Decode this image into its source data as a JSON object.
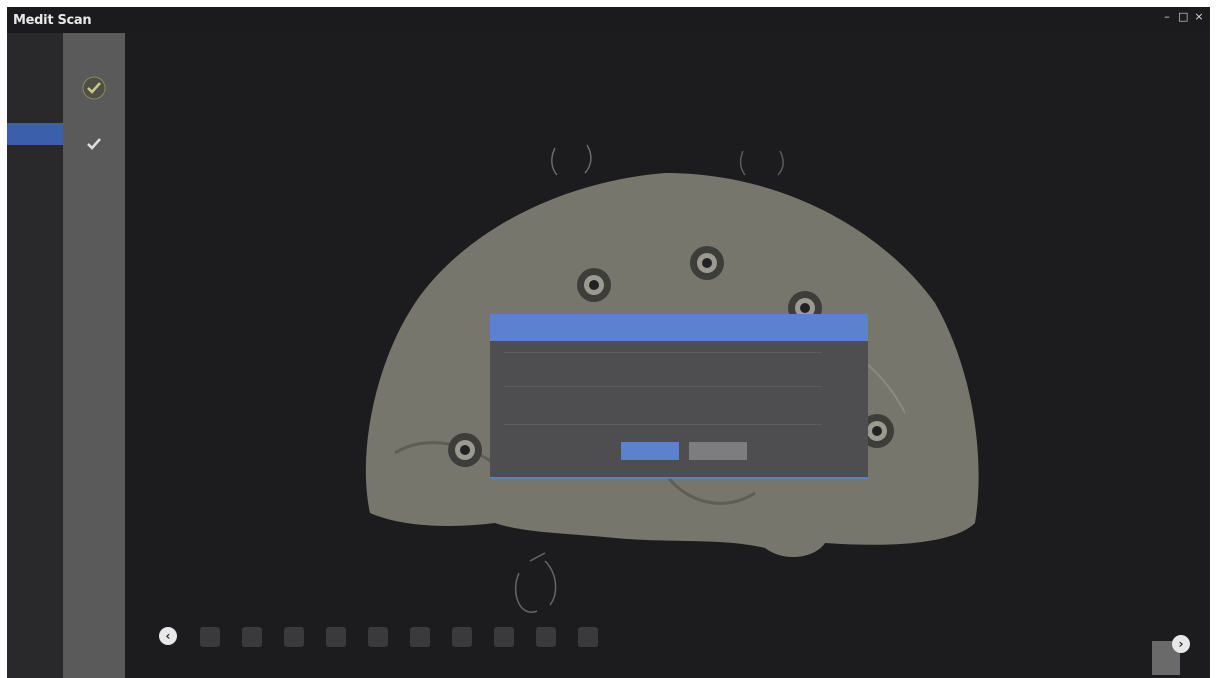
{
  "app": {
    "title": "Medit Scan",
    "version": ""
  },
  "window_controls": {
    "minimize": "–",
    "maximize": "□",
    "close": "×"
  },
  "sidebar": {
    "items": [
      {
        "label": ""
      },
      {
        "label": ""
      },
      {
        "label": ""
      }
    ]
  },
  "dialog": {
    "title": "",
    "message": "",
    "path": "",
    "ok_label": "",
    "cancel_label": ""
  },
  "toolbar": {
    "prev_icon": "chevron-left-icon",
    "tools": [
      {
        "icon": "tool-1-icon",
        "glyph": "",
        "label": ""
      },
      {
        "icon": "tool-2-icon",
        "glyph": "",
        "label": ""
      },
      {
        "icon": "tool-3-icon",
        "glyph": "",
        "label": ""
      },
      {
        "icon": "tool-4-icon",
        "glyph": "",
        "label": ""
      },
      {
        "icon": "tool-5-icon",
        "glyph": "",
        "label": ""
      },
      {
        "icon": "tool-6-icon",
        "glyph": "",
        "label": ""
      },
      {
        "icon": "tool-7-icon",
        "glyph": "",
        "label": ""
      },
      {
        "icon": "tool-8-icon",
        "glyph": "",
        "label": ""
      },
      {
        "icon": "tool-9-icon",
        "glyph": "",
        "label": ""
      },
      {
        "icon": "tool-10-icon",
        "glyph": "",
        "label": ""
      }
    ],
    "next_icon": "chevron-right-icon",
    "next_label": ""
  },
  "colors": {
    "accent": "#5b81cf",
    "background": "#1c1c1e",
    "model": "#76766c"
  }
}
